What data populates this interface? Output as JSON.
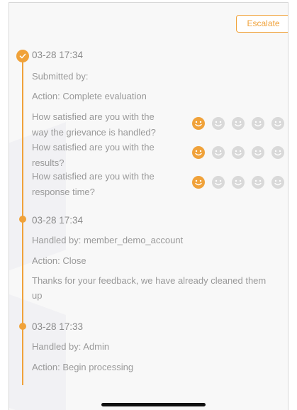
{
  "header": {
    "escalate_label": "Escalate"
  },
  "colors": {
    "accent": "#f0a23a",
    "text": "#999999",
    "face_inactive": "#d9d9d9"
  },
  "entries": [
    {
      "timestamp": "03-28 17:34",
      "by": "Submitted by:",
      "action": "Action: Complete evaluation",
      "ratings": [
        {
          "line1": "How satisfied are you with the",
          "line2": "way the grievance is handled?",
          "score": 1,
          "max": 5
        },
        {
          "line1": "How satisfied are you with the",
          "line2": "results?",
          "score": 1,
          "max": 5
        },
        {
          "line1": "How satisfied are you with the",
          "line2": "response time?",
          "score": 1,
          "max": 5
        }
      ]
    },
    {
      "timestamp": "03-28 17:34",
      "by": "Handled by: member_demo_account",
      "action": "Action: Close",
      "message_line1": "Thanks for your feedback, we have already cleaned them",
      "message_line2": "up"
    },
    {
      "timestamp": "03-28 17:33",
      "by": "Handled by: Admin",
      "action": "Action: Begin processing"
    }
  ]
}
